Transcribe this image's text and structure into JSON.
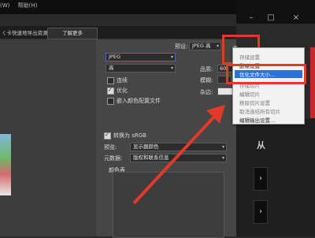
{
  "menubar": {
    "items": [
      "(W)",
      "帮助(H)"
    ]
  },
  "window_controls": {
    "minimize": "–",
    "maximize": "□",
    "close": "×"
  },
  "notice": {
    "text": "ㄑ卡快速地导出资源",
    "learn_more": "了解更多"
  },
  "settings": {
    "preset_label": "预设:",
    "preset_value": "JPEG 高",
    "format_value": "JPEG",
    "quality_preset_value": "高",
    "quality_label": "品质:",
    "quality_value": "60",
    "progressive_label": "连续",
    "progressive_checked": false,
    "blur_label": "模糊:",
    "optimized_label": "优化",
    "optimized_checked": true,
    "matte_label": "杂边:",
    "embed_profile_label": "嵌入颜色配置文件",
    "embed_profile_checked": false,
    "convert_srgb_label": "转换为 sRGB",
    "convert_srgb_checked": true,
    "preview_label": "预览:",
    "preview_value": "显示器颜色",
    "metadata_label": "元数据:",
    "metadata_value": "版权和联系信息",
    "color_table_label": "颜色表"
  },
  "popup_menu": {
    "items": [
      {
        "label": "存储设置",
        "state": "dim"
      },
      {
        "label": "删除设置",
        "state": "normal"
      },
      {
        "label": "优化文件大小...",
        "state": "highlight"
      },
      {
        "label": "存储切片",
        "state": "dim"
      },
      {
        "label": "编辑切片",
        "state": "dim"
      },
      {
        "label": "移除切片设置",
        "state": "dim"
      },
      {
        "label": "取消连结所有切片",
        "state": "dim"
      },
      {
        "label": "编辑输出设置...",
        "state": "normal"
      }
    ]
  },
  "side": {
    "from_label": "从",
    "next": "›",
    "next2": "›"
  },
  "colors": {
    "highlight": "#2a72d8",
    "annotation": "#e23a2a"
  },
  "icons": {
    "panel_menu": "panel-menu-icon",
    "arrow": "annotation-arrow"
  }
}
